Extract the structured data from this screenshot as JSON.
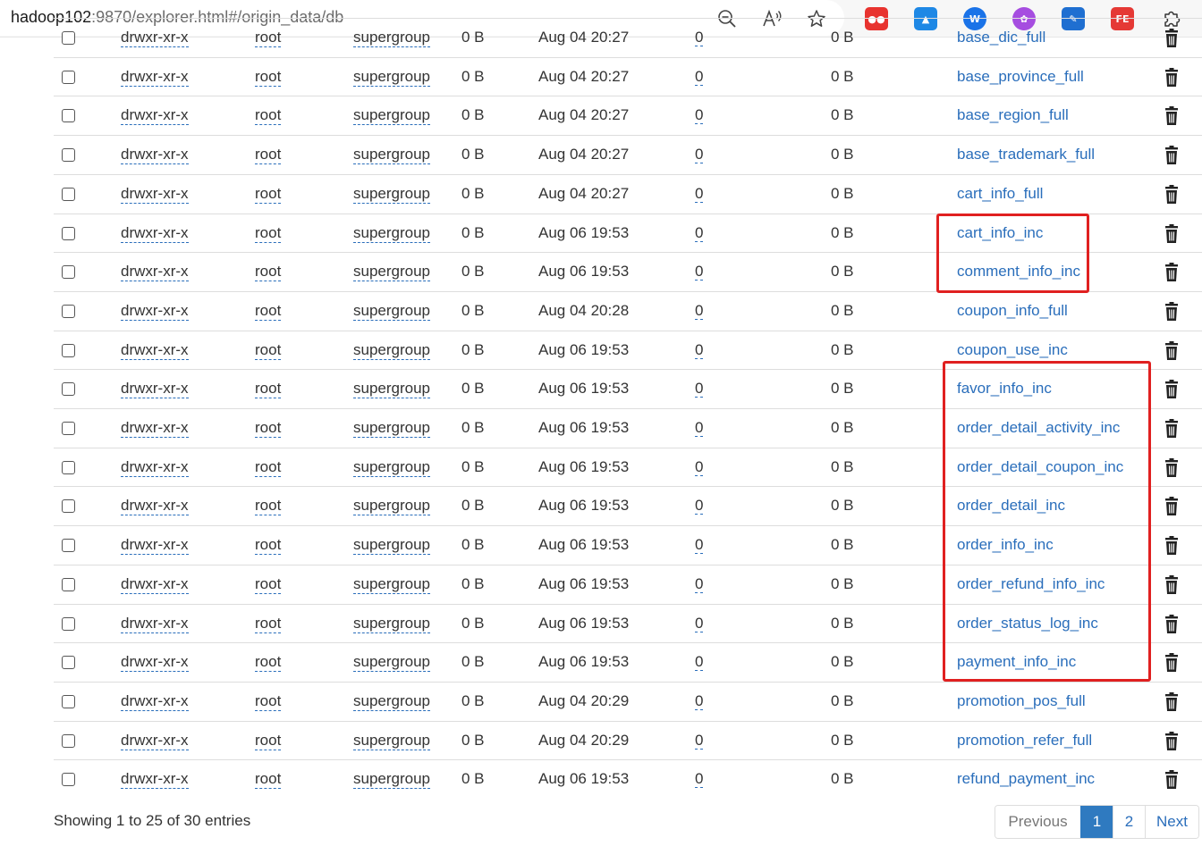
{
  "browser": {
    "url_host": "hadoop102",
    "url_rest": ":9870/explorer.html#/origin_data/db",
    "extensions": [
      {
        "icon": "extension-red-glasses-icon",
        "color": "#e8332f",
        "label": "●●"
      },
      {
        "icon": "extension-blue-bird-icon",
        "color": "#1e88e5",
        "label": "▲"
      },
      {
        "icon": "extension-blue-circle-icon",
        "color": "#1a73e8",
        "label": "W"
      },
      {
        "icon": "extension-brain-icon",
        "color": "#a64de0",
        "label": "✿"
      },
      {
        "icon": "extension-brush-icon",
        "color": "#1f6fd1",
        "label": "✎"
      },
      {
        "icon": "extension-fe-icon",
        "color": "#e53935",
        "label": "FE"
      },
      {
        "icon": "extensions-puzzle-icon",
        "color": "#333333",
        "label": ""
      }
    ]
  },
  "table": {
    "partial_top": {
      "permission": "drwxr-xr-x",
      "owner": "root",
      "group": "supergroup",
      "size": "0 B",
      "modified": "Aug 04 20:27",
      "replication": "0",
      "block_size": "0 B",
      "name": "base_dic_full"
    },
    "rows": [
      {
        "permission": "drwxr-xr-x",
        "owner": "root",
        "group": "supergroup",
        "size": "0 B",
        "modified": "Aug 04 20:27",
        "replication": "0",
        "block_size": "0 B",
        "name": "base_province_full"
      },
      {
        "permission": "drwxr-xr-x",
        "owner": "root",
        "group": "supergroup",
        "size": "0 B",
        "modified": "Aug 04 20:27",
        "replication": "0",
        "block_size": "0 B",
        "name": "base_region_full"
      },
      {
        "permission": "drwxr-xr-x",
        "owner": "root",
        "group": "supergroup",
        "size": "0 B",
        "modified": "Aug 04 20:27",
        "replication": "0",
        "block_size": "0 B",
        "name": "base_trademark_full"
      },
      {
        "permission": "drwxr-xr-x",
        "owner": "root",
        "group": "supergroup",
        "size": "0 B",
        "modified": "Aug 04 20:27",
        "replication": "0",
        "block_size": "0 B",
        "name": "cart_info_full"
      },
      {
        "permission": "drwxr-xr-x",
        "owner": "root",
        "group": "supergroup",
        "size": "0 B",
        "modified": "Aug 06 19:53",
        "replication": "0",
        "block_size": "0 B",
        "name": "cart_info_inc"
      },
      {
        "permission": "drwxr-xr-x",
        "owner": "root",
        "group": "supergroup",
        "size": "0 B",
        "modified": "Aug 06 19:53",
        "replication": "0",
        "block_size": "0 B",
        "name": "comment_info_inc"
      },
      {
        "permission": "drwxr-xr-x",
        "owner": "root",
        "group": "supergroup",
        "size": "0 B",
        "modified": "Aug 04 20:28",
        "replication": "0",
        "block_size": "0 B",
        "name": "coupon_info_full"
      },
      {
        "permission": "drwxr-xr-x",
        "owner": "root",
        "group": "supergroup",
        "size": "0 B",
        "modified": "Aug 06 19:53",
        "replication": "0",
        "block_size": "0 B",
        "name": "coupon_use_inc"
      },
      {
        "permission": "drwxr-xr-x",
        "owner": "root",
        "group": "supergroup",
        "size": "0 B",
        "modified": "Aug 06 19:53",
        "replication": "0",
        "block_size": "0 B",
        "name": "favor_info_inc"
      },
      {
        "permission": "drwxr-xr-x",
        "owner": "root",
        "group": "supergroup",
        "size": "0 B",
        "modified": "Aug 06 19:53",
        "replication": "0",
        "block_size": "0 B",
        "name": "order_detail_activity_inc"
      },
      {
        "permission": "drwxr-xr-x",
        "owner": "root",
        "group": "supergroup",
        "size": "0 B",
        "modified": "Aug 06 19:53",
        "replication": "0",
        "block_size": "0 B",
        "name": "order_detail_coupon_inc"
      },
      {
        "permission": "drwxr-xr-x",
        "owner": "root",
        "group": "supergroup",
        "size": "0 B",
        "modified": "Aug 06 19:53",
        "replication": "0",
        "block_size": "0 B",
        "name": "order_detail_inc"
      },
      {
        "permission": "drwxr-xr-x",
        "owner": "root",
        "group": "supergroup",
        "size": "0 B",
        "modified": "Aug 06 19:53",
        "replication": "0",
        "block_size": "0 B",
        "name": "order_info_inc"
      },
      {
        "permission": "drwxr-xr-x",
        "owner": "root",
        "group": "supergroup",
        "size": "0 B",
        "modified": "Aug 06 19:53",
        "replication": "0",
        "block_size": "0 B",
        "name": "order_refund_info_inc"
      },
      {
        "permission": "drwxr-xr-x",
        "owner": "root",
        "group": "supergroup",
        "size": "0 B",
        "modified": "Aug 06 19:53",
        "replication": "0",
        "block_size": "0 B",
        "name": "order_status_log_inc"
      },
      {
        "permission": "drwxr-xr-x",
        "owner": "root",
        "group": "supergroup",
        "size": "0 B",
        "modified": "Aug 06 19:53",
        "replication": "0",
        "block_size": "0 B",
        "name": "payment_info_inc"
      },
      {
        "permission": "drwxr-xr-x",
        "owner": "root",
        "group": "supergroup",
        "size": "0 B",
        "modified": "Aug 04 20:29",
        "replication": "0",
        "block_size": "0 B",
        "name": "promotion_pos_full"
      },
      {
        "permission": "drwxr-xr-x",
        "owner": "root",
        "group": "supergroup",
        "size": "0 B",
        "modified": "Aug 04 20:29",
        "replication": "0",
        "block_size": "0 B",
        "name": "promotion_refer_full"
      },
      {
        "permission": "drwxr-xr-x",
        "owner": "root",
        "group": "supergroup",
        "size": "0 B",
        "modified": "Aug 06 19:53",
        "replication": "0",
        "block_size": "0 B",
        "name": "refund_payment_inc"
      }
    ]
  },
  "footer": {
    "info": "Showing 1 to 25 of 30 entries",
    "previous": "Previous",
    "page1": "1",
    "page2": "2",
    "next": "Next"
  },
  "colors": {
    "link": "#2a6ebb",
    "highlight": "#e02020",
    "active_page": "#2f7ac0"
  }
}
